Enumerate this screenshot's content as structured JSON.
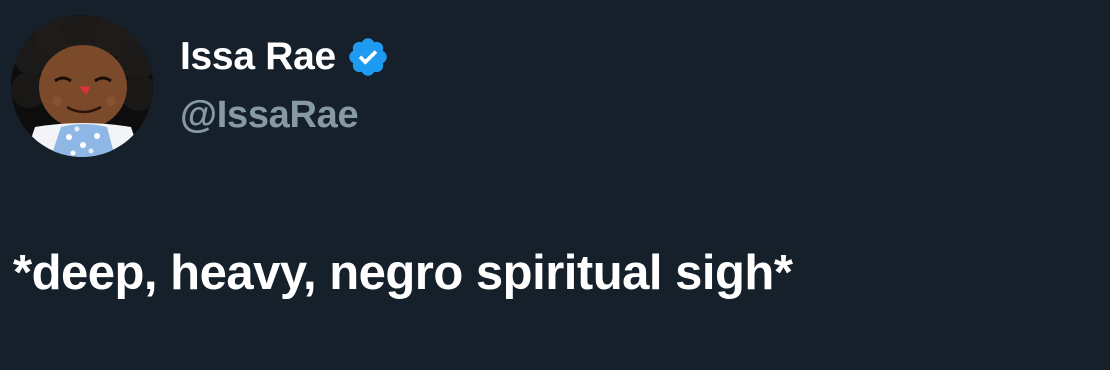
{
  "author": {
    "display_name": "Issa Rae",
    "handle": "@IssaRae",
    "verified": true,
    "verified_icon": "verified-badge-icon",
    "avatar_icon": "rag-doll-avatar"
  },
  "tweet": {
    "text": "*deep, heavy, negro spiritual sigh*"
  },
  "colors": {
    "background": "#15202b",
    "text_primary": "#ffffff",
    "text_secondary": "#8899a6",
    "verified_blue": "#1d9bf0"
  }
}
